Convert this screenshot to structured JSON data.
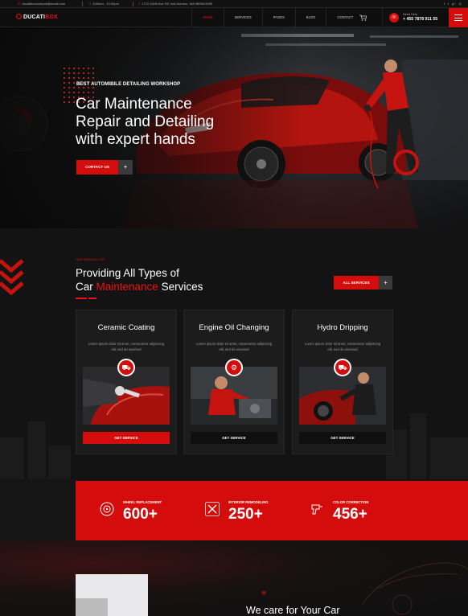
{
  "topbar": {
    "email": "ducatiboxcarepair@email.com",
    "hours": "8:00am - 10:00pm",
    "address": "1710 116th Ave SE Unit Arenton, WA 98058-5055",
    "social_icons": [
      "facebook-icon",
      "twitter-icon",
      "google-plus-icon",
      "instagram-icon"
    ]
  },
  "nav": {
    "logo_prefix": "DUCATI",
    "logo_suffix": "BOX",
    "menu": [
      "HOME",
      "SERVICES",
      "PAGES",
      "BLOG",
      "CONTACT"
    ],
    "active_index": 0,
    "help_label": "Need Help",
    "help_phone": "+ 455 7878 911 55"
  },
  "hero": {
    "subtitle": "BEST AUTOMIBILE DETAILING WORKSHOP",
    "title_lines": [
      "Car Maintenance",
      "Repair and Detailing",
      "with expert hands"
    ],
    "cta_label": "CONTACT US",
    "plus": "+"
  },
  "services": {
    "tag": "OUR SERVICE LIST",
    "title_line1": "Providing All Types of",
    "title_line2_pre": "Car ",
    "title_line2_highlight": "Maintenance",
    "title_line2_post": " Services",
    "all_label": "ALL SERVICES",
    "plus": "+",
    "cards": [
      {
        "title": "Ceramic Coating",
        "desc": "Lorem ipsum dolor sit amet, consectetur adipiscing elit, sed do eiusmod",
        "button": "GET SERVICE",
        "icon": "car-wash-icon",
        "button_style": "red"
      },
      {
        "title": "Engine Oil Changing",
        "desc": "Lorem ipsum dolor sit amet, consectetur adipiscing elit, sed do eiusmod",
        "button": "GET SERVICE",
        "icon": "car-repair-icon",
        "button_style": "dark"
      },
      {
        "title": "Hydro Dripping",
        "desc": "Lorem ipsum dolor sit amet, consectetur adipiscing elit, sed do eiusmod",
        "button": "GET SERVICE",
        "icon": "car-service-icon",
        "button_style": "dark"
      }
    ]
  },
  "stats": [
    {
      "label": "WHEEL REPLACEMENT",
      "value": "600+",
      "icon": "wheel-icon"
    },
    {
      "label": "INTERIOR REMODELING",
      "value": "250+",
      "icon": "tools-icon"
    },
    {
      "label": "COLOR CORRECTION",
      "value": "456+",
      "icon": "spray-gun-icon"
    }
  ],
  "about": {
    "title": "We care for Your Car"
  },
  "colors": {
    "accent": "#d40c0c",
    "background": "#131313",
    "card": "#1c1c1c"
  }
}
